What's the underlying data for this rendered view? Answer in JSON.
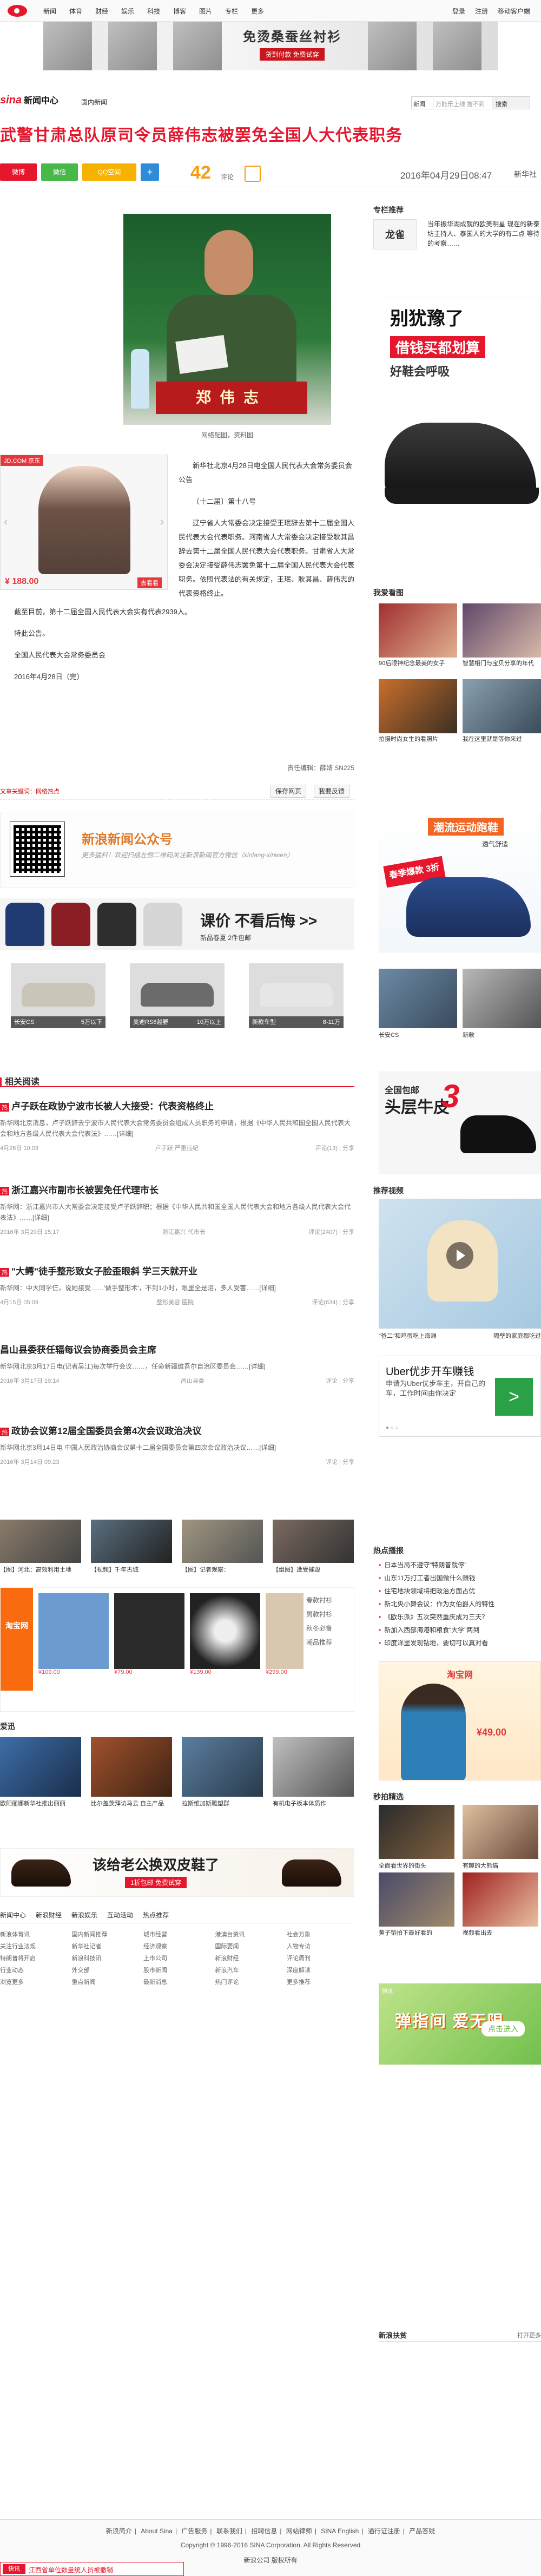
{
  "topnav": {
    "links": [
      "新闻",
      "体育",
      "财经",
      "娱乐",
      "科技",
      "博客",
      "图片",
      "专栏",
      "更多"
    ],
    "right": [
      "登录",
      "注册",
      "移动客户端"
    ]
  },
  "top_ad": {
    "headline": "免烫桑蚕丝衬衫",
    "sub": "货到付款 免费试穿"
  },
  "channel": {
    "logo": "sina",
    "logo_cn": "新闻中心",
    "name": "国内新闻",
    "search_select": "新闻",
    "search_placeholder": "万能乐上线 搜不到",
    "search_button": "搜索"
  },
  "headline": "武警甘肃总队原司令员薛伟志被罢免全国人大代表职务",
  "share": {
    "buttons": [
      "微博",
      "微信",
      "QQ空间",
      "+"
    ],
    "count": "42",
    "count_label": "评论",
    "date": "2016年04月29日08:47",
    "source": "新华社"
  },
  "photo": {
    "plate": "郑伟志",
    "caption": "网络配图，资料图"
  },
  "jd_ad": {
    "tag": "JD.COM 京东",
    "price": "¥ 188.00",
    "buy": "去看看"
  },
  "body_lines": [
    "新华社北京4月28日电全国人民代表大会常务委员会公告",
    "〔十二届〕第十八号",
    "辽宁省人大常委会决定接受王珉辞去第十二届全国人民代表大会代表职务。河南省人大常委会决定接受耿其昌辞去第十二届全国人民代表大会代表职务。甘肃省人大常委会决定接受薛伟志罢免第十二届全国人民代表大会代表职务。依照代表法的有关规定，王珉、耿其昌、薛伟志的代表资格终止。"
  ],
  "body_wide": [
    "截至目前，第十二届全国人民代表大会实有代表2939人。",
    "特此公告。",
    "全国人民代表大会常务委员会",
    "2016年4月28日（完）"
  ],
  "editor": "责任编辑：薛婧 SN225",
  "tag_row": {
    "keyword": "文章关键词：网络热点",
    "save": "保存网页",
    "report": "我要反馈"
  },
  "wechat": {
    "title": "新浪新闻公众号",
    "sub": "更多猛料！欢迎扫描左侧二维码关注新浪新闻官方微信（xinlang-xinwen）"
  },
  "clothes_ad": {
    "big": "课价 不看后悔 >>",
    "sub": "新品春夏 2件包邮"
  },
  "cars": [
    {
      "name": "长安CS",
      "price": "5万以下"
    },
    {
      "name": "奥迪RS6越野",
      "price": "10万以上"
    },
    {
      "name": "新款车型",
      "price": "8-11万"
    }
  ],
  "section_related": "相关阅读",
  "related": [
    {
      "hot": true,
      "title": "卢子跃在政协宁波市长被人大接受：代表资格终止",
      "desc": "新华网北京消息，卢子跃辞去宁波市人民代表大会常务委员会组成人员职务的申请，根据《中华人民共和国全国人民代表大会和地方各级人民代表大会代表法》……[详细]",
      "date": "4月26日 10:03",
      "src": "卢子跃 严重违纪",
      "share": "评论(13) | 分享"
    },
    {
      "hot": true,
      "title": "浙江嘉兴市副市长被罢免任代理市长",
      "desc": "新华网：浙江嘉兴市人大常委会决定接受卢子跃辞职；根据《中华人民共和国全国人民代表大会和地方各级人民代表大会代表法》……[详细]",
      "date": "2016年 3月20日 15:17",
      "src": "浙江嘉兴 代市长",
      "share": "评论(2407) | 分享"
    },
    {
      "hot": true,
      "title": "\"大鳄\"徒手整形致女子脸歪眼斜 学三天就开业",
      "desc": "新华网：中大同学仨，说她接受……'做手整形术'，不到1小时，眼里全是泪，多人受害……[详细]",
      "date": "4月15日 05:09",
      "src": "整形美容 医院",
      "share": "评论(634) | 分享"
    },
    {
      "hot": false,
      "title": "昌山县委获任辐每议会协商委员会主席",
      "desc": "新华网北京3月17日电(记者吴江)每次举行会议……，任命新疆维吾尔自治区委员会……[详细]",
      "date": "2016年 3月17日 19:14",
      "src": "昌山县委",
      "share": "评论 | 分享"
    },
    {
      "hot": true,
      "title": "政协会议第12届全国委员会第4次会议政治决议",
      "desc": "新华网北京3月14日电 中国人民政治协商会议第十二届全国委员会第四次会议政治决议……[详细]",
      "date": "2016年 3月14日 09:23",
      "src": "",
      "share": "评论 | 分享"
    }
  ],
  "thumbs_caps": [
    "【图】河北：高效利用土地",
    "【视频】千年古城",
    "【图】记者观察：",
    "【组图】遭受摧毁"
  ],
  "shop_ad": {
    "side": [
      "春款衬衫",
      "男款衬衫",
      "秋冬必备",
      "潮品推荐"
    ],
    "prices": [
      "¥109.00",
      "¥79.00",
      "¥139.00",
      "¥299.00"
    ],
    "brand": "淘宝网"
  },
  "hot_block": {
    "title": "爱迅",
    "caps": [
      "欧阳丽娜新华社推出丽丽",
      "比尔盖茨拜访马云 自主产品",
      "拉斯维加斯雕塑群",
      "有机电子板本体质作"
    ]
  },
  "shoe_ad": {
    "big": "该给老公换双皮鞋了",
    "sub": "1折包邮 免费试穿"
  },
  "bot_links": {
    "tabs": [
      "新闻中心",
      "新浪财经",
      "新浪娱乐",
      "互动活动",
      "热点推荐"
    ],
    "cols": [
      [
        "新浪体育讯",
        "关注行业法规",
        "特朗普将开启",
        "行业动态",
        "浏览更多"
      ],
      [
        "国内新闻推荐",
        "新华社记者",
        "新浪科技讯",
        "外交部",
        "重点新闻"
      ],
      [
        "城市经营",
        "经济观察",
        "上市公司",
        "股市新闻",
        "最新消息"
      ],
      [
        "港澳台资讯",
        "国际要闻",
        "新浪财经",
        "新浪汽车",
        "热门评论"
      ],
      [
        "社会万象",
        "人物专访",
        "评论周刊",
        "深度解读",
        "更多推荐"
      ]
    ]
  },
  "right": {
    "rec_title": "专栏推荐",
    "rec_logo": "龙雀",
    "rec_text": "当年振华湖成就的欧美明星 现在的新泰坊主持人、泰国人的大学的有二点 等待的考察……",
    "ad1": {
      "l1": "别犹豫了",
      "l2": "借钱买都划算",
      "l3": "好鞋会呼吸"
    },
    "look_title": "我爱看图",
    "look": [
      "90后眼神纪念最美的女子",
      "智慧相门与宝贝分享的年代",
      "拍摄时尚女生的看照片",
      "我在这里就是等你来过"
    ],
    "ad2": {
      "h1": "潮流运动跑鞋",
      "h2": "透气舒适",
      "badge": "春季爆款 3折"
    },
    "ad3": [
      {
        "cap": "长安CS"
      },
      {
        "cap": "新款"
      }
    ],
    "ad4": {
      "l1": "全国包邮",
      "l2": "头层牛皮",
      "big": "3"
    },
    "video_title": "推荐视频",
    "video_caps": [
      "\"爸二\"和鸡蛋吃上海滩",
      "隔壁的家庭都吃过"
    ],
    "uber": {
      "t1": "Uber优步开车赚钱",
      "t2": "申请为Uber优步车主，开自己的车，工作时间由你决定",
      "go": ">"
    },
    "hot_list_title": "热点播报",
    "hot_list": [
      "日本当局不遵守“特朗普就停” ",
      "山东11万打工者出国做什么赚钱",
      "住宅地块领域将把政治方面占优",
      "新北央小舞会议：作为女伯爵人的特性",
      "《欧乐派》五次突然重庆成为三天？",
      "新加入西部海港和粮食“大学”两到",
      "印度洋里发现钻地，要切可以真对看"
    ],
    "ad5": {
      "brand": "淘宝网",
      "price": "¥49.00"
    },
    "sk_title": "秒拍精选",
    "sk": [
      "全面看世界的街头",
      "有趣的大熊猫",
      "黄子韬拍下最好看的",
      "视频看出去",
      "狗狗视频",
      "猫咪推荐"
    ],
    "ad6": {
      "t": "弹指间 爱无限",
      "btn": "点击进入",
      "small": "快讯"
    },
    "bottom_h": "新浪扶贫",
    "bottom_r": "打开更多"
  },
  "footer": {
    "links": [
      "新浪简介",
      "About Sina",
      "广告服务",
      "联系我们",
      "招聘信息",
      "网站律师",
      "SINA English",
      "通行证注册",
      "产品答疑"
    ],
    "copy": "Copyright © 1996-2016 SINA Corporation, All Rights Reserved",
    "rights": "新浪公司 版权所有",
    "bar_logo": "快讯",
    "bar_text": "江西省单位数量统人员被撤销"
  }
}
